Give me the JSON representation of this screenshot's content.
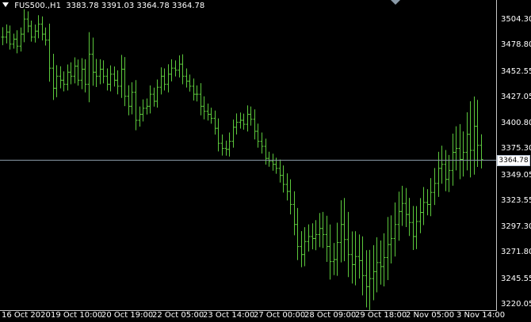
{
  "header": {
    "symbol": "FUS500.,H1",
    "ohlc": "3383.78 3391.03 3364.78 3364.78"
  },
  "current_price": "3364.78",
  "colors": {
    "bar": "#5cc83c",
    "price_line": "#8a9aa8",
    "background": "#000000",
    "text": "#ffffff"
  },
  "icons": {
    "menu": "dropdown-triangle-icon",
    "shift": "chart-shift-marker-icon"
  },
  "chart_data": {
    "type": "bar",
    "title": "",
    "xlabel": "",
    "ylabel": "",
    "ylim": [
      3214,
      3530
    ],
    "price_axis_ticks": [
      "3504.30",
      "3478.80",
      "3452.55",
      "3427.05",
      "3400.80",
      "3375.30",
      "3349.05",
      "3323.55",
      "3297.30",
      "3271.80",
      "3245.55",
      "3220.05"
    ],
    "time_axis_ticks": [
      "16 Oct 2020",
      "19 Oct 10:00",
      "20 Oct 19:00",
      "22 Oct 05:00",
      "23 Oct 14:00",
      "27 Oct 00:00",
      "28 Oct 09:00",
      "29 Oct 18:00",
      "2 Nov 05:00",
      "3 Nov 14:00"
    ],
    "current_price_line": 3364.78,
    "price_path": [
      3487,
      3492,
      3480,
      3485,
      3478,
      3490,
      3505,
      3498,
      3487,
      3493,
      3500,
      3490,
      3484,
      3456,
      3436,
      3448,
      3444,
      3440,
      3452,
      3448,
      3458,
      3444,
      3455,
      3440,
      3470,
      3452,
      3448,
      3455,
      3448,
      3440,
      3450,
      3444,
      3438,
      3455,
      3428,
      3418,
      3432,
      3404,
      3410,
      3416,
      3418,
      3430,
      3423,
      3437,
      3448,
      3440,
      3450,
      3456,
      3454,
      3460,
      3448,
      3443,
      3438,
      3430,
      3430,
      3418,
      3413,
      3410,
      3406,
      3396,
      3381,
      3376,
      3375,
      3383,
      3397,
      3402,
      3404,
      3400,
      3410,
      3405,
      3393,
      3383,
      3378,
      3366,
      3363,
      3360,
      3356,
      3349,
      3340,
      3333,
      3320,
      3300,
      3278,
      3270,
      3283,
      3288,
      3286,
      3290,
      3296,
      3290,
      3278,
      3263,
      3265,
      3282,
      3300,
      3285,
      3270,
      3260,
      3268,
      3264,
      3249,
      3238,
      3246,
      3253,
      3262,
      3258,
      3267,
      3280,
      3286,
      3300,
      3313,
      3321,
      3310,
      3302,
      3288,
      3303,
      3312,
      3322,
      3320,
      3332,
      3341,
      3356,
      3360,
      3345,
      3354,
      3372,
      3376,
      3365,
      3372,
      3390,
      3374,
      3398,
      3379,
      3365
    ],
    "bar_ranges": [
      18,
      14,
      12,
      10,
      16,
      12,
      18,
      14,
      10,
      12,
      16,
      14,
      12,
      30,
      26,
      20,
      18,
      16,
      14,
      18,
      16,
      12,
      20,
      18,
      40,
      30,
      24,
      18,
      16,
      14,
      16,
      14,
      18,
      26,
      22,
      20,
      18,
      22,
      14,
      16,
      14,
      16,
      12,
      14,
      16,
      14,
      18,
      16,
      14,
      16,
      18,
      14,
      12,
      14,
      16,
      20,
      18,
      14,
      12,
      14,
      18,
      16,
      14,
      16,
      14,
      16,
      14,
      12,
      16,
      14,
      18,
      14,
      16,
      14,
      12,
      14,
      12,
      16,
      18,
      20,
      22,
      24,
      30,
      28,
      26,
      22,
      24,
      26,
      28,
      30,
      34,
      40,
      30,
      36,
      44,
      48,
      50,
      42,
      46,
      40,
      44,
      46,
      52,
      48,
      46,
      40,
      44,
      50,
      42,
      40,
      36,
      32,
      28,
      30,
      30,
      28,
      26,
      28,
      24,
      26,
      28,
      30,
      34,
      26,
      28,
      34,
      40,
      44,
      38,
      40,
      60,
      54,
      48,
      20
    ]
  }
}
